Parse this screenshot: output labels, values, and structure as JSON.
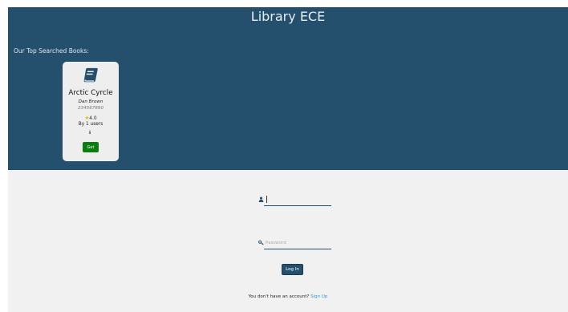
{
  "header": {
    "title": "Library ECE"
  },
  "top_books": {
    "label": "Our Top Searched Books:",
    "books": [
      {
        "title": "Arctic Cyrcle",
        "author": "Dan Brown",
        "isbn": "234567890",
        "rating": "4.0",
        "users": "By 1 users",
        "info_glyph": "ℹ",
        "get_label": "Get"
      }
    ]
  },
  "login": {
    "username_placeholder": "",
    "password_placeholder": "Password",
    "button_label": "Log In",
    "signup_prompt": "You don't have an account?",
    "signup_link": "Sign Up"
  },
  "colors": {
    "header_bg": "#24506e",
    "get_button": "#0a7d12",
    "link": "#2a9cd3",
    "star": "#f0b400"
  },
  "icons": {
    "book": "book-icon",
    "star": "star-icon",
    "info": "info-icon",
    "user": "user-icon",
    "key": "key-icon"
  }
}
